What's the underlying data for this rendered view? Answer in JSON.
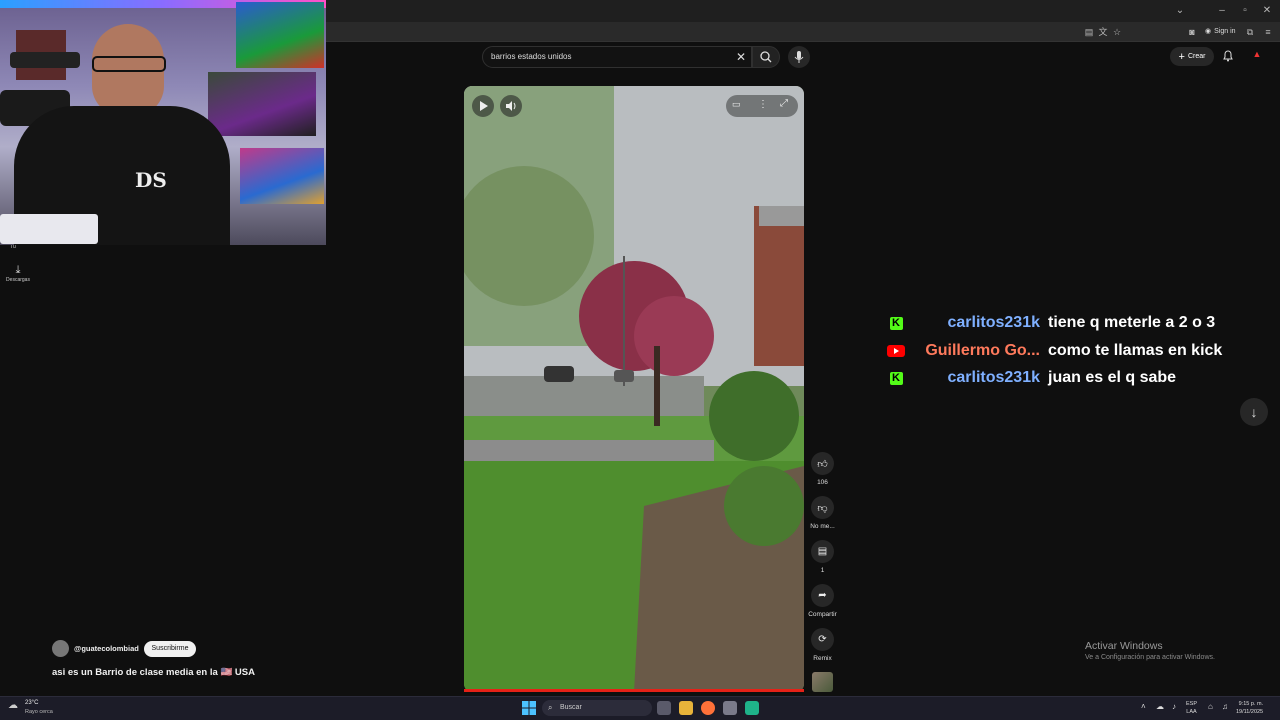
{
  "browser": {
    "sign_in": "Sign in"
  },
  "masthead": {
    "search_value": "barrios estados unidos",
    "create_label": "Crear"
  },
  "nav": {
    "tu_label": "Tú",
    "downloads_label": "Descargas"
  },
  "video_actions": {
    "like_count": "106",
    "dislike_label": "No me...",
    "comments_count": "1",
    "share_label": "Compartir",
    "remix_label": "Remix"
  },
  "channel": {
    "handle": "@guatecolombiad",
    "subscribe_label": "Suscribirme"
  },
  "video_title": "asi es un Barrio de clase media en la 🇺🇸 USA",
  "chat": [
    {
      "platform": "kick",
      "user": "carlitos231k",
      "message": "tiene q meterle a 2 o 3",
      "user_color": "#7fb0ff"
    },
    {
      "platform": "youtube",
      "user": "Guillermo Go...",
      "message": "como te llamas en kick",
      "user_color": "#ff7a5c"
    },
    {
      "platform": "kick",
      "user": "carlitos231k",
      "message": "juan es el q sabe",
      "user_color": "#7fb0ff"
    }
  ],
  "activate_windows": {
    "title": "Activar Windows",
    "subtitle": "Ve a Configuración para activar Windows."
  },
  "taskbar": {
    "weather_temp": "23°C",
    "weather_desc": "Rayo cerca",
    "search_placeholder": "Buscar",
    "lang_line1": "ESP",
    "lang_line2": "LAA",
    "time": "9:15 p. m.",
    "date": "19/11/2025"
  },
  "colors": {
    "accent_red": "#e62117",
    "kick_green": "#53fc18",
    "youtube_red": "#ff0000"
  }
}
